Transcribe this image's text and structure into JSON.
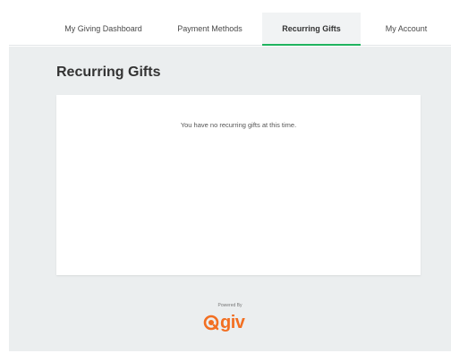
{
  "nav": {
    "tabs": [
      {
        "label": "My Giving Dashboard"
      },
      {
        "label": "Payment Methods"
      },
      {
        "label": "Recurring Gifts"
      },
      {
        "label": "My Account"
      }
    ],
    "active_tab": "Recurring Gifts"
  },
  "main": {
    "title": "Recurring Gifts",
    "empty_message": "You have no recurring gifts at this time."
  },
  "footer": {
    "powered_by": "Powered By",
    "logo_text": "Qgiv"
  },
  "colors": {
    "accent": "#1fb35f",
    "brand": "#f26f22",
    "background": "#ebeeef"
  }
}
